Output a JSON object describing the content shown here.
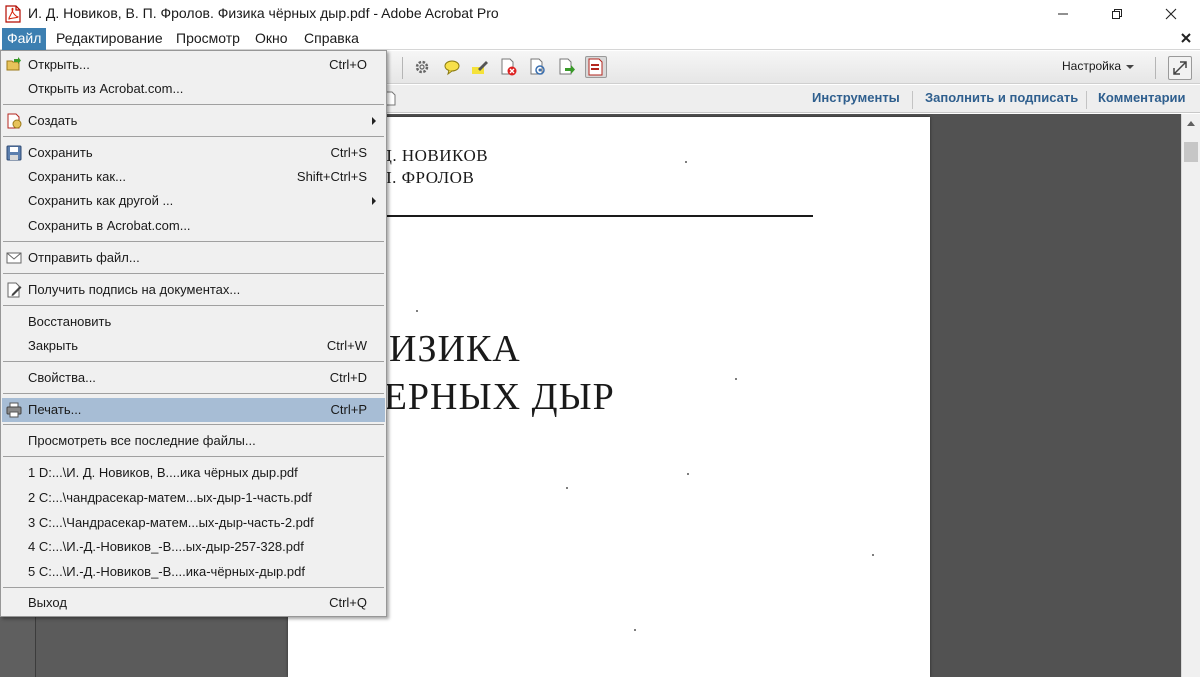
{
  "window": {
    "title": "И. Д. Новиков, В. П. Фролов. Физика чёрных дыр.pdf - Adobe Acrobat Pro",
    "app_icon": "acrobat-pdf-icon",
    "controls": [
      "minimize-icon",
      "maximize-icon",
      "close-icon"
    ]
  },
  "menubar": {
    "items": [
      {
        "label": "Файл"
      },
      {
        "label": "Редактирование"
      },
      {
        "label": "Просмотр"
      },
      {
        "label": "Окно"
      },
      {
        "label": "Справка"
      }
    ],
    "active_index": 0,
    "close_document_icon": "close-x-icon",
    "active_color": "#3c7fb1"
  },
  "toolbar": {
    "icons": [
      "gear-icon",
      "comment-icon",
      "highlight-icon",
      "delete-page-icon",
      "scan-icon",
      "export-icon",
      "form-icon"
    ],
    "customize_label": "Настройка",
    "expand_icon": "expand-icon"
  },
  "panes": {
    "tabs": [
      {
        "label": "Инструменты"
      },
      {
        "label": "Заполнить и подписать"
      },
      {
        "label": "Комментарии"
      }
    ],
    "tab_color": "#2f5f8e"
  },
  "document": {
    "authors": [
      "И. Д. НОВИКОВ",
      "В. П. ФРОЛОВ"
    ],
    "title_lines": [
      "ФИЗИКА",
      "ЧЕРНЫХ ДЫР"
    ]
  },
  "file_menu": {
    "highlight_color": "#a7bdd5",
    "items": [
      {
        "label": "Открыть...",
        "shortcut": "Ctrl+O",
        "icon": "open-folder-icon"
      },
      {
        "label": "Открыть из Acrobat.com...",
        "shortcut": ""
      },
      {
        "label": "Создать",
        "shortcut": "",
        "icon": "create-pdf-icon",
        "submenu": true
      },
      {
        "label": "Сохранить",
        "shortcut": "Ctrl+S",
        "icon": "save-icon"
      },
      {
        "label": "Сохранить как...",
        "shortcut": "Shift+Ctrl+S"
      },
      {
        "label": "Сохранить как другой ...",
        "shortcut": "",
        "submenu": true
      },
      {
        "label": "Сохранить в Acrobat.com...",
        "shortcut": ""
      },
      {
        "label": "Отправить файл...",
        "shortcut": "",
        "icon": "envelope-icon"
      },
      {
        "label": "Получить подпись на документах...",
        "shortcut": "",
        "icon": "sign-document-icon"
      },
      {
        "label": "Восстановить",
        "shortcut": ""
      },
      {
        "label": "Закрыть",
        "shortcut": "Ctrl+W"
      },
      {
        "label": "Свойства...",
        "shortcut": "Ctrl+D"
      },
      {
        "label": "Печать...",
        "shortcut": "Ctrl+P",
        "icon": "printer-icon",
        "highlighted": true
      },
      {
        "label": "Просмотреть все последние файлы...",
        "shortcut": ""
      },
      {
        "label": "1 D:...\\И. Д. Новиков, В....ика чёрных дыр.pdf",
        "shortcut": ""
      },
      {
        "label": "2 C:...\\чандрасекар-матем...ых-дыр-1-часть.pdf",
        "shortcut": ""
      },
      {
        "label": "3 C:...\\Чандрасекар-матем...ых-дыр-часть-2.pdf",
        "shortcut": ""
      },
      {
        "label": "4 C:...\\И.-Д.-Новиков_-В....ых-дыр-257-328.pdf",
        "shortcut": ""
      },
      {
        "label": "5 C:...\\И.-Д.-Новиков_-В....ика-чёрных-дыр.pdf",
        "shortcut": ""
      },
      {
        "label": "Выход",
        "shortcut": "Ctrl+Q"
      }
    ]
  }
}
